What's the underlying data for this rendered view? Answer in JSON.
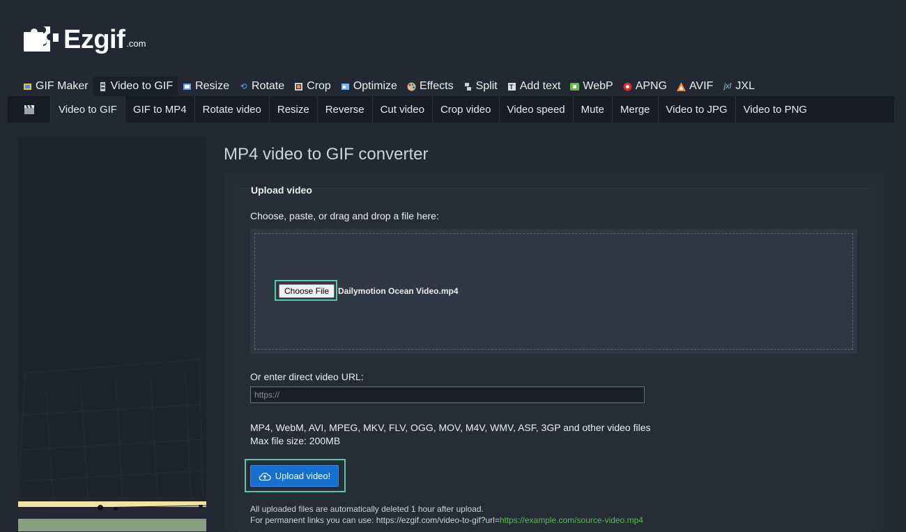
{
  "logo": {
    "text": "Ezgif",
    "domain": ".com"
  },
  "main_nav": [
    {
      "label": "GIF Maker",
      "icon": "gif-maker-icon"
    },
    {
      "label": "Video to GIF",
      "icon": "film-icon",
      "active": true
    },
    {
      "label": "Resize",
      "icon": "resize-icon"
    },
    {
      "label": "Rotate",
      "icon": "rotate-icon"
    },
    {
      "label": "Crop",
      "icon": "crop-icon"
    },
    {
      "label": "Optimize",
      "icon": "optimize-icon"
    },
    {
      "label": "Effects",
      "icon": "palette-icon"
    },
    {
      "label": "Split",
      "icon": "split-icon"
    },
    {
      "label": "Add text",
      "icon": "text-icon"
    },
    {
      "label": "WebP",
      "icon": "webp-icon"
    },
    {
      "label": "APNG",
      "icon": "apng-icon"
    },
    {
      "label": "AVIF",
      "icon": "avif-icon"
    },
    {
      "label": "JXL",
      "icon": "jxl-icon"
    }
  ],
  "sub_nav": [
    {
      "label": "Video to GIF",
      "active": true
    },
    {
      "label": "GIF to MP4"
    },
    {
      "label": "Rotate video"
    },
    {
      "label": "Resize"
    },
    {
      "label": "Reverse"
    },
    {
      "label": "Cut video"
    },
    {
      "label": "Crop video"
    },
    {
      "label": "Video speed"
    },
    {
      "label": "Mute"
    },
    {
      "label": "Merge"
    },
    {
      "label": "Video to JPG"
    },
    {
      "label": "Video to PNG"
    }
  ],
  "page_title": "MP4 video to GIF converter",
  "upload": {
    "legend": "Upload video",
    "choose_label": "Choose, paste, or drag and drop a file here:",
    "choose_button": "Choose File",
    "file_name": "Dailymotion Ocean Video.mp4",
    "url_label": "Or enter direct video URL:",
    "url_placeholder": "https://",
    "url_value": "",
    "formats": "MP4, WebM, AVI, MPEG, MKV, FLV, OGG, MOV, M4V, WMV, ASF, 3GP and other video files",
    "max_size": "Max file size: 200MB",
    "upload_button": "Upload video!",
    "note_line1": "All uploaded files are automatically deleted 1 hour after upload.",
    "note_line2_prefix": "For permanent links you can use: https://ezgif.com/video-to-gif?url=",
    "note_line2_link": "https://example.com/source-video.mp4"
  },
  "colors": {
    "background": "#222834",
    "accent_highlight": "#53c9a9",
    "upload_button": "#1570d0",
    "link": "#56c048"
  }
}
